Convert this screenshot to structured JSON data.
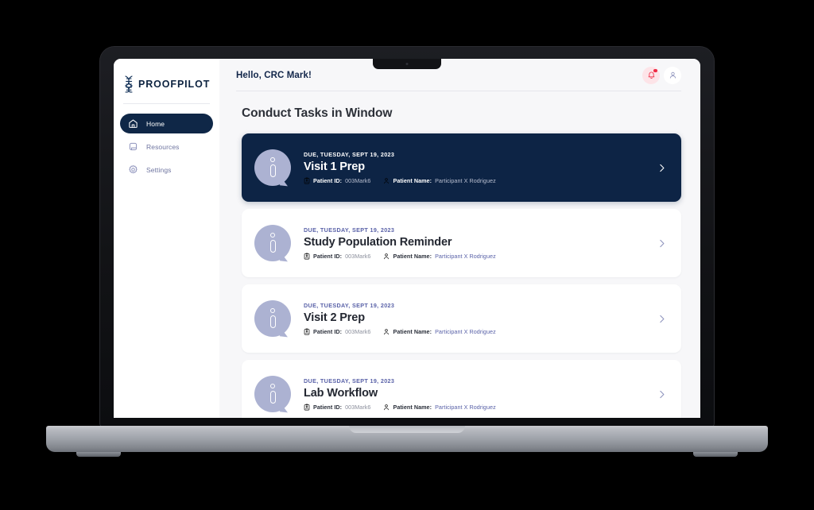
{
  "colors": {
    "brand_navy": "#0d2445",
    "accent_purple": "#5a62a8",
    "alert_red": "#ef2b45",
    "avatar_lavender": "#acb2d2",
    "page_bg": "#f7f7f9"
  },
  "sidebar": {
    "logo_text": "PROOFPILOT",
    "logo_icon": "dna-helix-icon",
    "items": [
      {
        "label": "Home",
        "icon": "home-icon",
        "active": true
      },
      {
        "label": "Resources",
        "icon": "book-icon",
        "active": false
      },
      {
        "label": "Settings",
        "icon": "gear-icon",
        "active": false
      }
    ]
  },
  "topbar": {
    "greeting": "Hello, CRC Mark!",
    "notification_icon": "bell-icon",
    "notification_has_unread": true,
    "account_icon": "user-icon"
  },
  "main": {
    "page_title": "Conduct Tasks in Window",
    "meta_labels": {
      "patient_id": "Patient ID:",
      "patient_name": "Patient Name:"
    },
    "tasks": [
      {
        "due": "DUE, TUESDAY, SEPT 19, 2023",
        "title": "Visit 1 Prep",
        "patient_id": "003Mark6",
        "patient_name": "Participant X Rodriguez",
        "highlighted": true,
        "icon": "info-bubble-icon",
        "chevron": "chevron-right-icon"
      },
      {
        "due": "DUE, TUESDAY, SEPT 19, 2023",
        "title": "Study Population Reminder",
        "patient_id": "003Mark6",
        "patient_name": "Participant X Rodriguez",
        "highlighted": false,
        "icon": "info-bubble-icon",
        "chevron": "chevron-right-icon"
      },
      {
        "due": "DUE, TUESDAY, SEPT 19, 2023",
        "title": "Visit 2 Prep",
        "patient_id": "003Mark6",
        "patient_name": "Participant X Rodriguez",
        "highlighted": false,
        "icon": "info-bubble-icon",
        "chevron": "chevron-right-icon"
      },
      {
        "due": "DUE, TUESDAY, SEPT 19, 2023",
        "title": "Lab Workflow",
        "patient_id": "003Mark6",
        "patient_name": "Participant X Rodriguez",
        "highlighted": false,
        "icon": "info-bubble-icon",
        "chevron": "chevron-right-icon"
      }
    ]
  }
}
